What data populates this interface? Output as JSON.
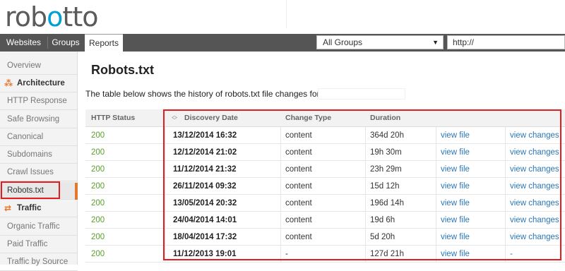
{
  "header": {
    "logo_pre": "rob",
    "logo_oo": "o",
    "logo_post": "tto",
    "logo_text": "robotto"
  },
  "nav": {
    "tabs": [
      {
        "label": "Websites"
      },
      {
        "label": "Groups"
      },
      {
        "label": "Reports"
      }
    ],
    "group_select": "All Groups",
    "url_value": "http://"
  },
  "sidebar": {
    "items": [
      {
        "label": "Overview",
        "type": "item"
      },
      {
        "label": "Architecture",
        "type": "section"
      },
      {
        "label": "HTTP Response",
        "type": "item"
      },
      {
        "label": "Safe Browsing",
        "type": "item"
      },
      {
        "label": "Canonical",
        "type": "item"
      },
      {
        "label": "Subdomains",
        "type": "item"
      },
      {
        "label": "Crawl Issues",
        "type": "item"
      },
      {
        "label": "Robots.txt",
        "type": "item"
      },
      {
        "label": "Traffic",
        "type": "section"
      },
      {
        "label": "Organic Traffic",
        "type": "item"
      },
      {
        "label": "Paid Traffic",
        "type": "item"
      },
      {
        "label": "Traffic by Source",
        "type": "item"
      }
    ]
  },
  "main": {
    "title": "Robots.txt",
    "description": "The table below shows the history of robots.txt file changes for http:/",
    "columns": [
      "HTTP Status",
      "Discovery Date",
      "Change Type",
      "Duration"
    ],
    "rows": [
      {
        "status": "200",
        "date": "13/12/2014 16:32",
        "type": "content",
        "duration": "364d 20h",
        "view_file": "view file",
        "view_changes": "view changes"
      },
      {
        "status": "200",
        "date": "12/12/2014 21:02",
        "type": "content",
        "duration": "19h 30m",
        "view_file": "view file",
        "view_changes": "view changes"
      },
      {
        "status": "200",
        "date": "11/12/2014 21:32",
        "type": "content",
        "duration": "23h 29m",
        "view_file": "view file",
        "view_changes": "view changes"
      },
      {
        "status": "200",
        "date": "26/11/2014 09:32",
        "type": "content",
        "duration": "15d 12h",
        "view_file": "view file",
        "view_changes": "view changes"
      },
      {
        "status": "200",
        "date": "13/05/2014 20:32",
        "type": "content",
        "duration": "196d 14h",
        "view_file": "view file",
        "view_changes": "view changes"
      },
      {
        "status": "200",
        "date": "24/04/2014 14:01",
        "type": "content",
        "duration": "19d 6h",
        "view_file": "view file",
        "view_changes": "view changes"
      },
      {
        "status": "200",
        "date": "18/04/2014 17:32",
        "type": "content",
        "duration": "5d 20h",
        "view_file": "view file",
        "view_changes": "view changes"
      },
      {
        "status": "200",
        "date": "11/12/2013 19:01",
        "type": "-",
        "duration": "127d 21h",
        "view_file": "view file",
        "view_changes": "-"
      }
    ]
  },
  "colors": {
    "accent_orange": "#e6762b",
    "status_green": "#5aa02c",
    "link_blue": "#2a77b7",
    "highlight_red": "#e21d1d",
    "nav_bg": "#555555"
  },
  "icons": {
    "architecture": "sitemap-icon",
    "traffic": "arrows-icon",
    "sort": "sort-icon",
    "dropdown": "caret-down-icon"
  }
}
